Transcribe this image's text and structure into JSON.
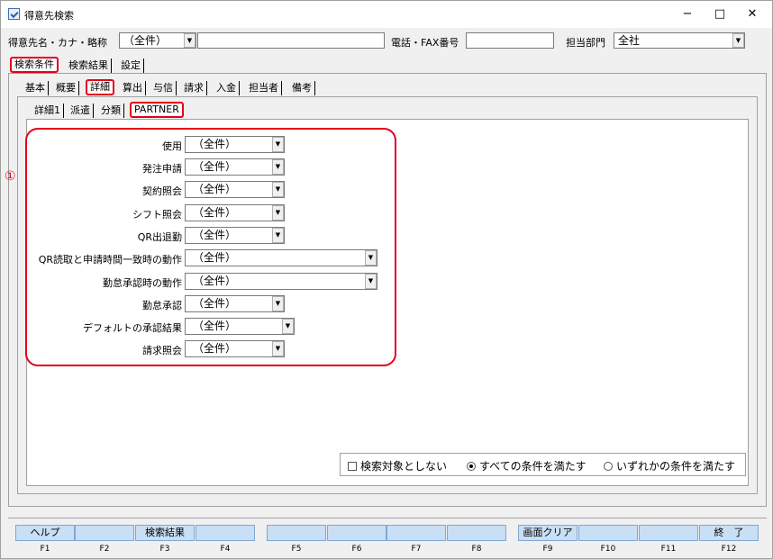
{
  "window": {
    "title": "得意先検索",
    "minimize": "−",
    "maximize": "□",
    "close": "✕"
  },
  "header": {
    "name_label": "得意先名・カナ・略称",
    "name_mode": "（全件）",
    "name_value": "",
    "phone_label": "電話・FAX番号",
    "phone_value": "",
    "dept_label": "担当部門",
    "dept_value": "全社"
  },
  "main_tabs": [
    "検索条件",
    "検索結果",
    "設定"
  ],
  "sub_tabs": [
    "基本",
    "概要",
    "詳細",
    "算出",
    "与信",
    "請求",
    "入金",
    "担当者",
    "備考"
  ],
  "detail_tabs": [
    "詳細1",
    "派遣",
    "分類",
    "PARTNER"
  ],
  "marker": "①",
  "fields": [
    {
      "label": "使用",
      "value": "（全件）"
    },
    {
      "label": "発注申請",
      "value": "（全件）"
    },
    {
      "label": "契約照会",
      "value": "（全件）"
    },
    {
      "label": "シフト照会",
      "value": "（全件）"
    },
    {
      "label": "QR出退勤",
      "value": "（全件）"
    },
    {
      "label": "QR読取と申請時間一致時の動作",
      "value": "（全件）"
    },
    {
      "label": "勤怠承認時の動作",
      "value": "（全件）"
    },
    {
      "label": "勤怠承認",
      "value": "（全件）"
    },
    {
      "label": "デフォルトの承認結果",
      "value": "（全件）"
    },
    {
      "label": "請求照会",
      "value": "（全件）"
    }
  ],
  "options": {
    "exclude": "検索対象としない",
    "all": "すべての条件を満たす",
    "any": "いずれかの条件を満たす"
  },
  "fkeys": [
    {
      "label": "ヘルプ",
      "key": "F1"
    },
    {
      "label": "",
      "key": "F2"
    },
    {
      "label": "検索結果",
      "key": "F3"
    },
    {
      "label": "",
      "key": "F4"
    },
    {
      "label": "",
      "key": "F5"
    },
    {
      "label": "",
      "key": "F6"
    },
    {
      "label": "",
      "key": "F7"
    },
    {
      "label": "",
      "key": "F8"
    },
    {
      "label": "画面クリア",
      "key": "F9"
    },
    {
      "label": "",
      "key": "F10"
    },
    {
      "label": "",
      "key": "F11"
    },
    {
      "label": "終　了",
      "key": "F12"
    }
  ],
  "colors": {
    "highlight": "#e3001b",
    "fkey": "#c9dff5"
  }
}
